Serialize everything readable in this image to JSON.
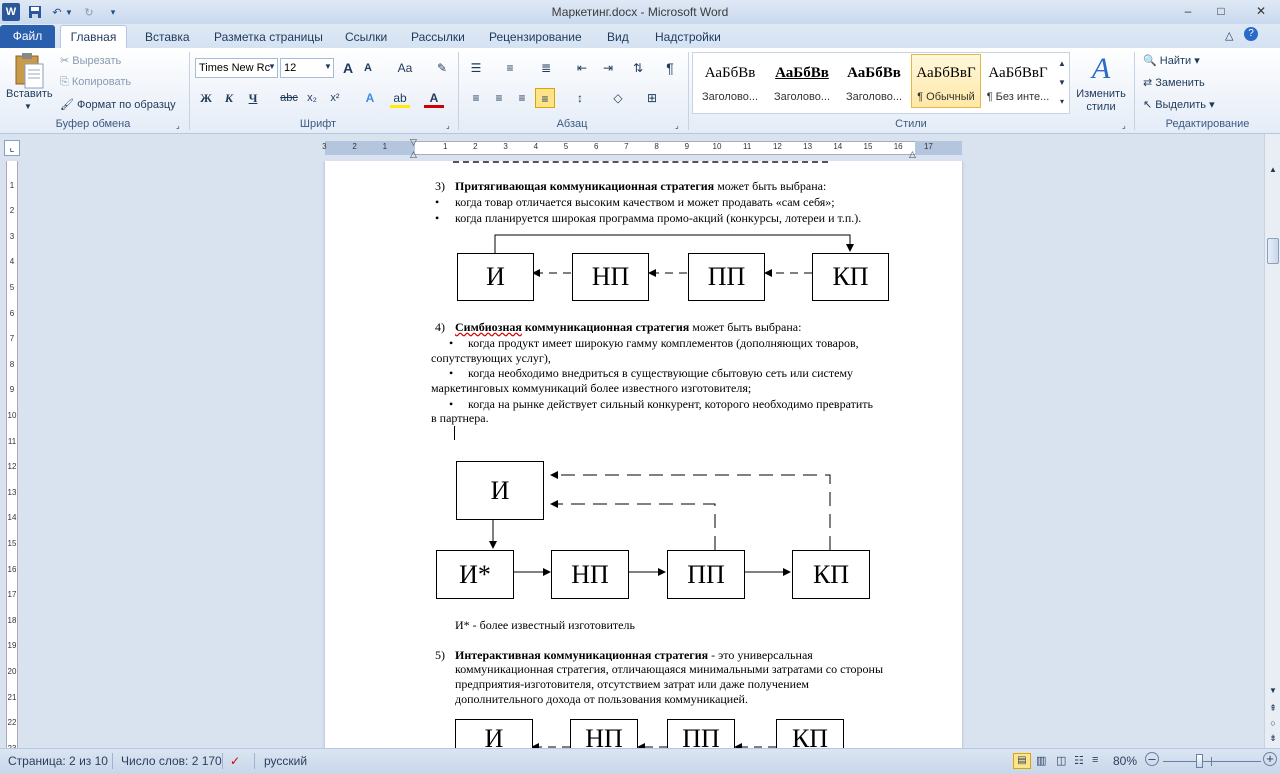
{
  "window": {
    "title": "Маркетинг.docx - Microsoft Word",
    "minimize": "–",
    "maximize": "□",
    "close": "✕"
  },
  "tabs": [
    "Файл",
    "Главная",
    "Вставка",
    "Разметка страницы",
    "Ссылки",
    "Рассылки",
    "Рецензирование",
    "Вид",
    "Надстройки"
  ],
  "ribbon": {
    "clipboard": {
      "group_label": "Буфер обмена",
      "paste": "Вставить",
      "cut": "Вырезать",
      "copy": "Копировать",
      "format_painter": "Формат по образцу"
    },
    "font": {
      "group_label": "Шрифт",
      "font_name": "Times New Rc",
      "font_size": "12",
      "bold": "Ж",
      "italic": "К",
      "underline": "Ч",
      "strike": "abc",
      "subscript": "x₂",
      "superscript": "x²",
      "grow": "A",
      "shrink": "A",
      "change_case": "Aa"
    },
    "paragraph": {
      "group_label": "Абзац",
      "pilcrow": "¶"
    },
    "styles": {
      "group_label": "Стили",
      "items": [
        {
          "sample": "АаБбВв",
          "name": "Заголово..."
        },
        {
          "sample": "АаБбВв",
          "name": "Заголово..."
        },
        {
          "sample": "АаБбВв",
          "name": "Заголово..."
        },
        {
          "sample": "АаБбВвГ",
          "name": "¶ Обычный"
        },
        {
          "sample": "АаБбВвГ",
          "name": "¶ Без инте..."
        }
      ],
      "change_styles": "Изменить стили"
    },
    "editing": {
      "group_label": "Редактирование",
      "find": "Найти",
      "replace": "Заменить",
      "select": "Выделить"
    }
  },
  "document": {
    "item3_num": "3)",
    "item3_bold": "Притягивающая коммуникационная стратегия",
    "item3_rest": " может быть выбрана:",
    "item3_b1": "когда товар отличается высоким качеством и может продавать «сам себя»;",
    "item3_b2": "когда планируется широкая программа промо-акций (конкурсы, лотереи и т.п.).",
    "diagram1": [
      "И",
      "НП",
      "ПП",
      "КП"
    ],
    "item4_num": "4)",
    "item4_bold1": "Симбиозная",
    "item4_bold2": " коммуникационная стратегия",
    "item4_rest": "  может быть выбрана:",
    "item4_b1_l1": "когда  продукт  имеет  широкую  гамму  комплементов  (дополняющих  товаров,",
    "item4_b1_l2": "сопутствующих услуг),",
    "item4_b2_l1": "когда  необходимо  внедриться  в  существующие  сбытовую  сеть  или  систему",
    "item4_b2_l2": "маркетинговых коммуникаций более известного изготовителя;",
    "item4_b3_l1": "когда на рынке действует сильный конкурент, которого необходимо превратить",
    "item4_b3_l2": "в партнера.",
    "diagram2_top": "И",
    "diagram2_row": [
      "И*",
      "НП",
      "ПП",
      "КП"
    ],
    "footnote": "И* - более известный изготовитель",
    "item5_num": "5)",
    "item5_bold": "Интерактивная   коммуникационная   стратегия",
    "item5_l1_rest": "  -  это  универсальная",
    "item5_l2": "коммуникационная стратегия, отличающаяся минимальными затратами со стороны",
    "item5_l3": "предприятия-изготовителя,   отсутствием   затрат   или   даже   получением",
    "item5_l4": "дополнительного дохода от пользования коммуникацией.",
    "diagram3": [
      "И",
      "НП",
      "ПП",
      "КП"
    ]
  },
  "status": {
    "page": "Страница: 2 из 10",
    "words": "Число слов: 2 170",
    "language": "русский",
    "zoom": "80%",
    "zoom_level": 0.8
  }
}
